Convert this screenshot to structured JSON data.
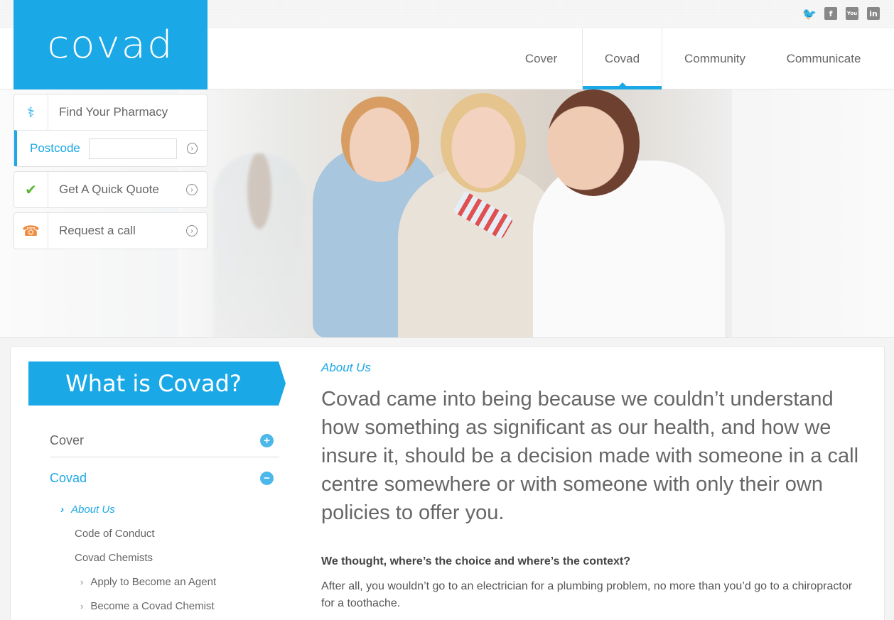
{
  "brand": {
    "logo_text": "covad",
    "accent": "#1ba8e6"
  },
  "social": [
    "twitter-icon",
    "facebook-icon",
    "youtube-icon",
    "linkedin-icon"
  ],
  "social_glyphs": {
    "facebook": "f",
    "youtube": "You",
    "linkedin": "in"
  },
  "nav": [
    "Cover",
    "Covad",
    "Community",
    "Communicate"
  ],
  "widgets": {
    "pharmacy": {
      "label": "Find Your Pharmacy",
      "postcode_label": "Postcode",
      "postcode_value": ""
    },
    "quote": {
      "label": "Get A Quick Quote"
    },
    "call": {
      "label": "Request a call"
    }
  },
  "sidebar": {
    "title": "What is Covad?",
    "items": [
      {
        "label": "Cover",
        "state": "collapsed"
      },
      {
        "label": "Covad",
        "state": "expanded"
      }
    ],
    "subitems": [
      "About Us",
      "Code of Conduct",
      "Covad Chemists"
    ],
    "subsubitems": [
      "Apply to Become an Agent",
      "Become a Covad Chemist"
    ],
    "toggle_glyphs": {
      "collapsed": "+",
      "expanded": "−"
    }
  },
  "main": {
    "breadcrumb": "About Us",
    "lead": "Covad came into being because we couldn’t understand how something as significant as our health, and how we insure it, should be a decision made with someone in a call centre somewhere or with someone with only their own policies to offer you.",
    "question": "We thought, where’s the choice and where’s the context?",
    "paragraph": "After all, you wouldn’t go to an electrician for a plumbing problem, no more than you’d go to a chiropractor for a toothache."
  }
}
